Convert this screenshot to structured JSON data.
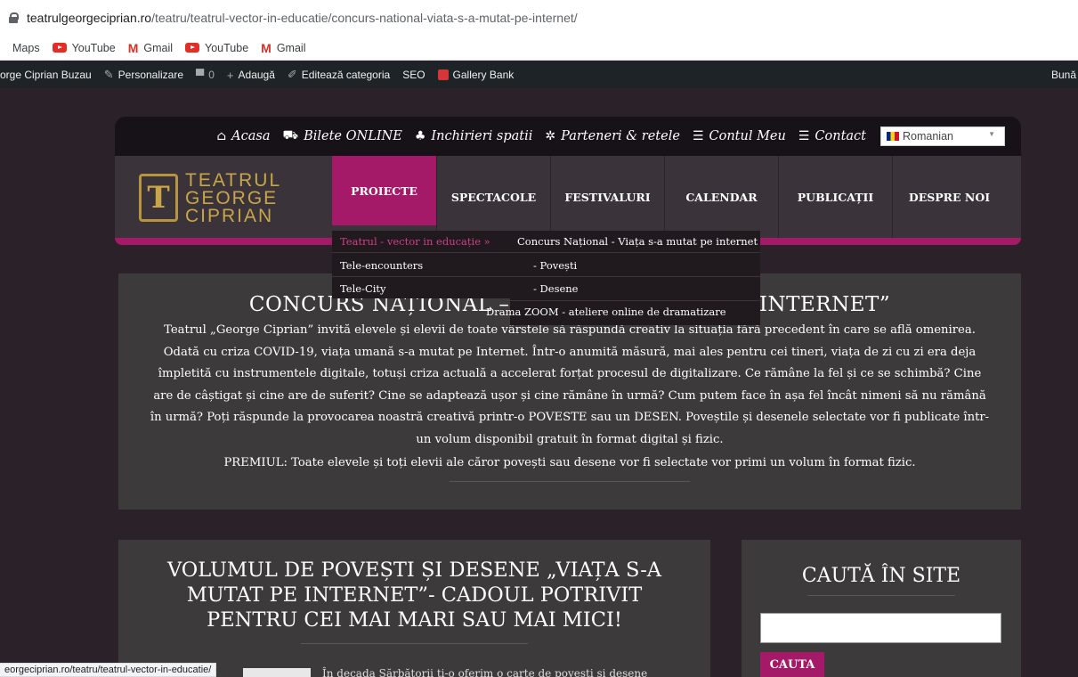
{
  "browser": {
    "url_host": "teatrulgeorgeciprian.ro",
    "url_path": "/teatru/teatrul-vector-in-educatie/concurs-national-viata-s-a-mutat-pe-internet/",
    "bookmarks": [
      "Maps",
      "YouTube",
      "Gmail",
      "YouTube",
      "Gmail"
    ],
    "status_url": "eorgeciprian.ro/teatru/teatrul-vector-in-educatie/"
  },
  "adminbar": {
    "site": "orge Ciprian Buzau",
    "personalize": "Personalizare",
    "comments": "0",
    "add": "Adaugă",
    "edit_category": "Editează categoria",
    "seo": "SEO",
    "gallery": "Gallery Bank",
    "greeting": "Bună"
  },
  "topnav": {
    "home": "Acasa",
    "tickets": "Bilete ONLINE",
    "rentals": "Inchirieri spatii",
    "partners": "Parteneri & retele",
    "account": "Contul Meu",
    "contact": "Contact",
    "language": "Romanian"
  },
  "logo": {
    "line1": "TEATRUL",
    "line2": "GEORGE",
    "line3": "CIPRIAN"
  },
  "menu": [
    "PROIECTE",
    "SPECTACOLE",
    "FESTIVALURI",
    "CALENDAR",
    "PUBLICAȚII",
    "DESPRE NOI"
  ],
  "dropdown": {
    "left": [
      "Teatrul - vector in educație »",
      "Tele-encounters",
      "Tele-City"
    ],
    "right": [
      "Concurs Național - Viața s-a mutat pe internet",
      "- Povești",
      "- Desene",
      "Drama ZOOM - ateliere online de dramatizare"
    ]
  },
  "article": {
    "title": "CONCURS NAȚIONAL – VIAȚA S-A MUTAT PE INTERNET”",
    "body": "Teatrul „George Ciprian” invită elevele și elevii de toate vârstele să răspundă creativ la situația fără precedent în care se află omenirea. Odată cu criza COVID-19, viața umană s-a mutat pe Internet. Într-o anumită măsură, mai ales pentru cei tineri, viața de zi cu zi era deja împletită cu instrumentele digitale, totuși criza actuală a accelerat forțat procesul de digitalizare. Ce rămâne la fel și ce se schimbă? Cine are de câștigat și cine are de suferit? Cine se adaptează ușor și cine rămâne în urmă? Cum putem face în așa fel încât nimeni să nu rămână în urmă? Poți răspunde la provocarea noastră creativă printr-o POVESTE sau un DESEN. Poveștile și desenele selectate vor fi publicate într-un volum disponibil gratuit în format digital și fizic.",
    "prize": "PREMIUL: Toate elevele și toți elevii ale căror povești sau desene vor fi selectate vor primi un volum în format fizic."
  },
  "post": {
    "title": "VOLUMUL DE POVEȘTI ȘI DESENE „VIAȚA S-A MUTAT PE INTERNET”- CADOUL POTRIVIT PENTRU CEI MAI MARI SAU MAI MICI!",
    "excerpt": "În decada Sărbătorii ți-o oferim o carte de povești și desene"
  },
  "sidebar": {
    "search_title": "CAUTĂ ÎN SITE",
    "search_value": "",
    "search_button": "CAUTA"
  }
}
